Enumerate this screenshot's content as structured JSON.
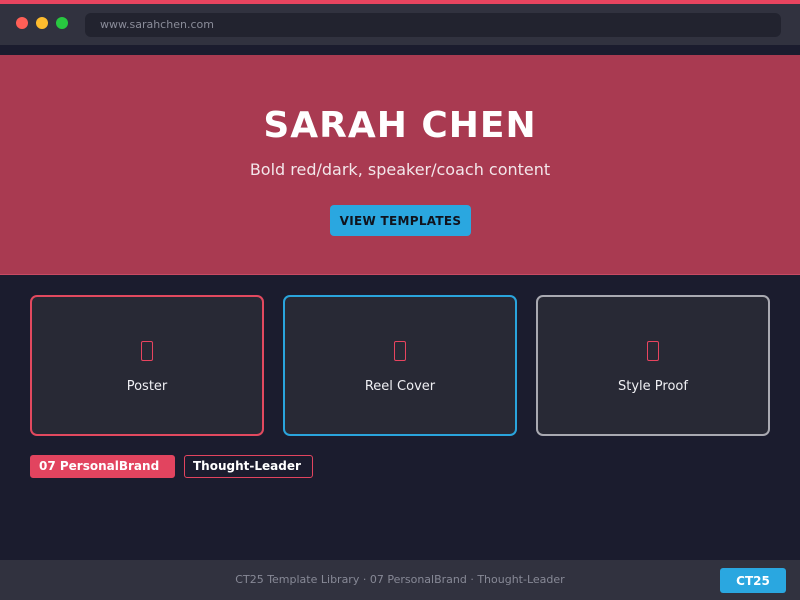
{
  "browser": {
    "url": "www.sarahchen.com"
  },
  "hero": {
    "title": "SARAH CHEN",
    "subtitle": "Bold red/dark, speaker/coach content",
    "button_label": "VIEW TEMPLATES"
  },
  "cards": [
    {
      "label": "Poster",
      "icon": "missing-glyph-icon"
    },
    {
      "label": "Reel Cover",
      "icon": "missing-glyph-icon"
    },
    {
      "label": "Style Proof",
      "icon": "missing-glyph-icon"
    }
  ],
  "tags": [
    {
      "label": "07 PersonalBrand"
    },
    {
      "label": "Thought-Leader"
    }
  ],
  "footer": {
    "text": "CT25 Template Library · 07 PersonalBrand · Thought-Leader",
    "badge": "CT25"
  },
  "colors": {
    "accent_red": "#e8445f",
    "hero_bg": "#a93a51",
    "accent_blue": "#2aa7e0",
    "page_bg": "#1b1c2e"
  }
}
